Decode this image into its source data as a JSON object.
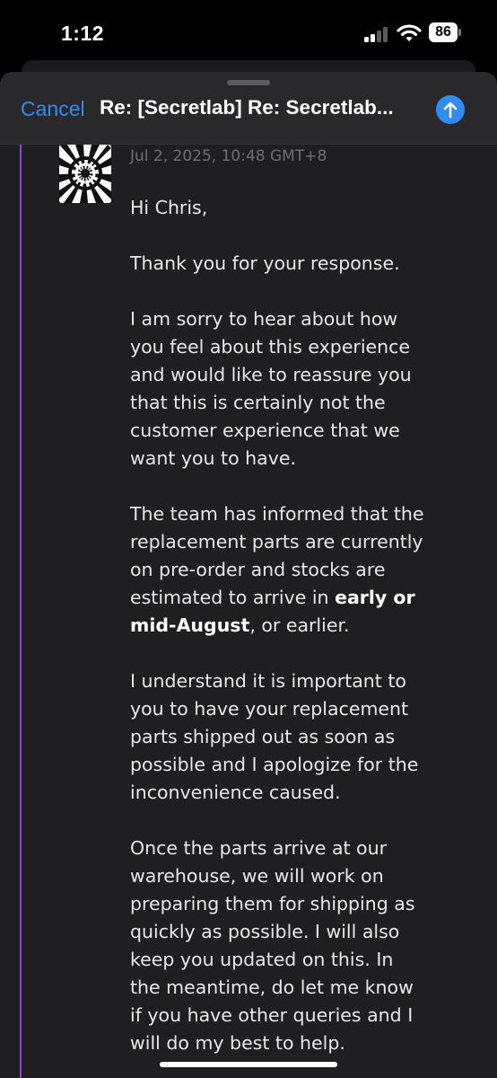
{
  "status": {
    "time": "1:12",
    "battery": "86"
  },
  "compose": {
    "cancel_label": "Cancel",
    "subject": "Re: [Secretlab] Re: Secretlab...",
    "send_icon": "arrow-up-icon",
    "accent_color": "#2f8cf0",
    "quote_bar_color": "#8a47d6"
  },
  "message": {
    "date": "Jul 2, 2025, 10:48 GMT+8",
    "greeting": "Hi Chris,",
    "p1": "Thank you for your response.",
    "p2": {
      "l1": "I am sorry to hear about how",
      "l2": "you feel about this experience",
      "l3": "and would like to reassure you",
      "l4": "that this is certainly not the",
      "l5": "customer experience that we",
      "l6": "want you to have."
    },
    "p3": {
      "l1": "The team has informed that the",
      "l2": "replacement parts are currently",
      "l3": "on pre-order and stocks are",
      "l4a": "estimated to arrive in ",
      "l4b": "early or",
      "l5a": "mid-August",
      "l5b": ", or earlier."
    },
    "p4": {
      "l1": "I understand it is important to",
      "l2": "you to have your replacement",
      "l3": "parts shipped out as soon as",
      "l4": "possible and I apologize for the",
      "l5": "inconvenience caused."
    },
    "p5": {
      "l1": "Once the parts arrive at our",
      "l2": "warehouse, we will work on",
      "l3": "preparing them for shipping as",
      "l4": "quickly as possible. I will also",
      "l5": "keep you updated on this. In",
      "l6": "the meantime, do let me know",
      "l7": "if you have other queries and I",
      "l8": "will do my best to help."
    }
  }
}
